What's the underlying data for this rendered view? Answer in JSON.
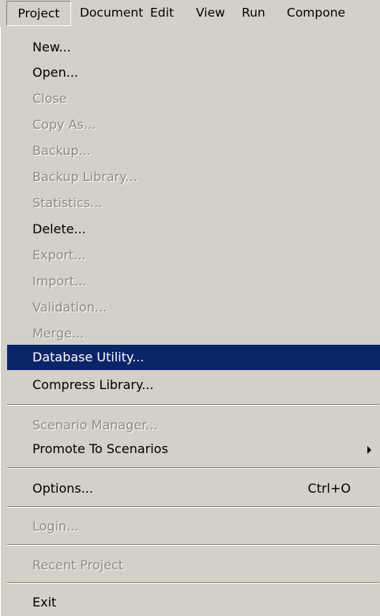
{
  "menubar": {
    "items": [
      {
        "label": "Project"
      },
      {
        "label": "Document"
      },
      {
        "label": "Edit"
      },
      {
        "label": "View"
      },
      {
        "label": "Run"
      },
      {
        "label": "Compone"
      }
    ]
  },
  "menu": {
    "items": [
      {
        "label": "New...",
        "enabled": true
      },
      {
        "label": "Open...",
        "enabled": true
      },
      {
        "label": "Close",
        "enabled": false
      },
      {
        "label": "Copy As...",
        "enabled": false
      },
      {
        "label": "Backup...",
        "enabled": false
      },
      {
        "label": "Backup Library...",
        "enabled": false
      },
      {
        "label": "Statistics...",
        "enabled": false
      },
      {
        "label": "Delete...",
        "enabled": true
      },
      {
        "label": "Export...",
        "enabled": false
      },
      {
        "label": "Import...",
        "enabled": false
      },
      {
        "label": "Validation...",
        "enabled": false
      },
      {
        "label": "Merge...",
        "enabled": false
      },
      {
        "label": "Database Utility...",
        "enabled": true,
        "highlighted": true
      },
      {
        "label": "Compress Library...",
        "enabled": true
      },
      {
        "label": "Scenario Manager...",
        "enabled": false
      },
      {
        "label": "Promote To Scenarios",
        "enabled": true,
        "has_submenu": true
      },
      {
        "label": "Options...",
        "enabled": true,
        "shortcut": "Ctrl+O"
      },
      {
        "label": "Login...",
        "enabled": false
      },
      {
        "label": "Recent Project",
        "enabled": false
      },
      {
        "label": "Exit",
        "enabled": true
      }
    ],
    "highlight_color": "#0a246a",
    "disabled_color": "#8d8a85",
    "background_color": "#d4d0c8"
  }
}
